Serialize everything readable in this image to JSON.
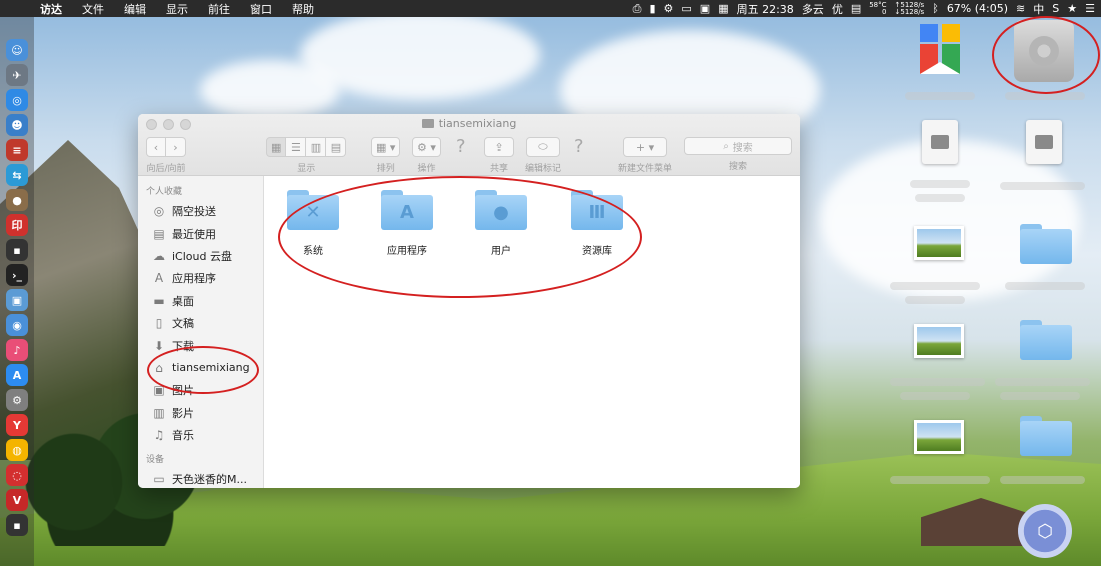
{
  "menubar": {
    "app_name": "访达",
    "menus": [
      "文件",
      "编辑",
      "显示",
      "前往",
      "窗口",
      "帮助"
    ],
    "datetime": "周五 22:38",
    "weather": "多云",
    "weather_quality": "优",
    "cpu_temp": "58°C",
    "cpu_usage": "0",
    "net_up": "↑5128/s",
    "net_down": "↓5128/s",
    "battery": "67% (4:05)",
    "input_method": "中"
  },
  "window": {
    "title": "tiansemixiang",
    "toolbar": {
      "back_forward_label": "向后/向前",
      "view_label": "显示",
      "arrange_label": "排列",
      "action_label": "操作",
      "share_label": "共享",
      "tags_label": "编辑标记",
      "new_folder_label": "新建文件菜单",
      "search_label": "搜索",
      "search_placeholder": "搜索"
    },
    "sidebar": {
      "favorites_header": "个人收藏",
      "favorites": [
        {
          "label": "隔空投送",
          "icon": "airdrop-icon"
        },
        {
          "label": "最近使用",
          "icon": "recents-icon"
        },
        {
          "label": "iCloud 云盘",
          "icon": "cloud-icon"
        },
        {
          "label": "应用程序",
          "icon": "applications-icon"
        },
        {
          "label": "桌面",
          "icon": "desktop-icon"
        },
        {
          "label": "文稿",
          "icon": "documents-icon"
        },
        {
          "label": "下载",
          "icon": "download-icon"
        },
        {
          "label": "tiansemixiang",
          "icon": "home-icon"
        },
        {
          "label": "图片",
          "icon": "pictures-icon"
        },
        {
          "label": "影片",
          "icon": "movies-icon"
        },
        {
          "label": "音乐",
          "icon": "music-icon"
        }
      ],
      "devices_header": "设备",
      "devices": [
        {
          "label": "天色迷香的M...",
          "icon": "laptop-icon"
        }
      ]
    },
    "folders": [
      {
        "label": "系统",
        "icon": "system-folder-icon"
      },
      {
        "label": "应用程序",
        "icon": "applications-folder-icon"
      },
      {
        "label": "用户",
        "icon": "users-folder-icon"
      },
      {
        "label": "资源库",
        "icon": "library-folder-icon"
      }
    ]
  },
  "colors": {
    "annotation": "#d42020",
    "folder_blue": "#74b7ec"
  }
}
